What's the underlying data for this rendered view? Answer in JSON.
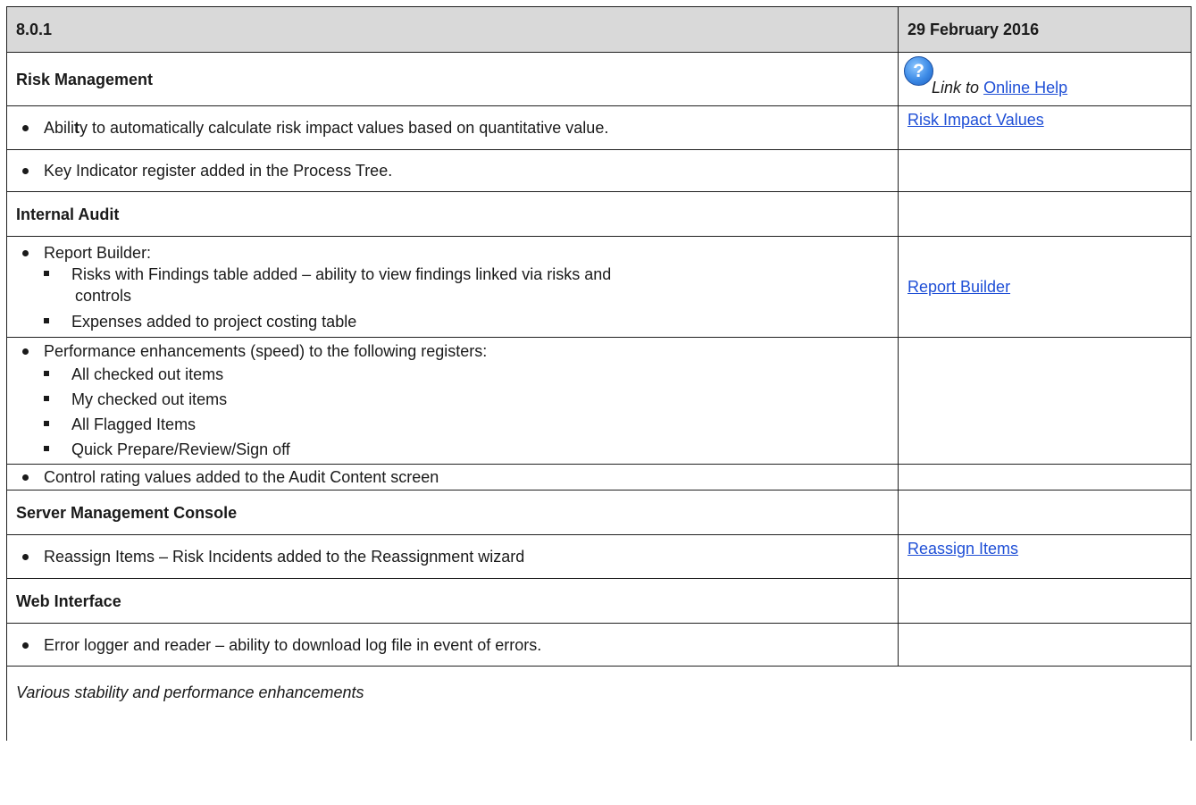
{
  "header": {
    "version": "8.0.1",
    "date": "29 February 2016"
  },
  "help": {
    "icon": "question-circle-icon",
    "prefix": "Link to",
    "link": "Online Help"
  },
  "risk_management": {
    "title": "Risk Management",
    "item1": {
      "text_a": "Abili",
      "text_b": "t",
      "text_c": "y to automatically calculate risk impact values based on quantitative value.",
      "link": "Risk Impact Values"
    },
    "item2": {
      "text": "Key Indicator register added in the Process Tree."
    }
  },
  "internal_audit": {
    "title": "Internal Audit",
    "report_builder": {
      "text": "Report Builder:",
      "sub1_line1": "Risks with Findings table added – ability to view findings linked via risks and",
      "sub1_line2": "controls",
      "sub2": "Expenses added to project costing table",
      "link": "Report Builder"
    },
    "performance": {
      "text": "Performance enhancements (speed) to the following registers:",
      "items": [
        "All checked out items",
        "My checked out items",
        "All Flagged Items",
        "Quick Prepare/Review/Sign off"
      ]
    },
    "control_rating": "Control rating values added to the Audit Content screen"
  },
  "server_console": {
    "title": "Server Management Console",
    "item": "Reassign Items – Risk Incidents added to the Reassignment wizard",
    "link": "Reassign Items"
  },
  "web_interface": {
    "title": "Web Interface",
    "item": "Error logger and reader – ability to download log file in event of errors."
  },
  "footer": "Various stability and performance enhancements"
}
